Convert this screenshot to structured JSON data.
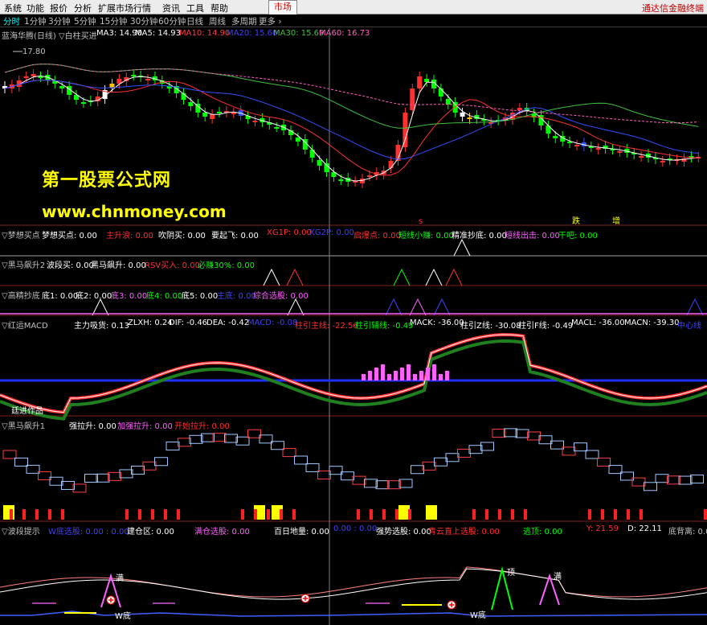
{
  "menu": {
    "items": [
      "系统",
      "功能",
      "报价",
      "分析",
      "扩展市场行情",
      "资讯",
      "工具",
      "帮助"
    ],
    "market_tab": "市场",
    "brand": "通达信金融终端"
  },
  "timeframes": {
    "items": [
      "分时",
      "1分钟",
      "3分钟",
      "5分钟",
      "15分钟",
      "30分钟",
      "60分钟",
      "日线",
      "周线",
      "多周期",
      "更多 ›"
    ],
    "active": "分时"
  },
  "main_panel": {
    "title": "蓝海华腾(日线) ▽白柱买进",
    "indicators": [
      {
        "label": "MA3: 14.90",
        "color": "#ffffff"
      },
      {
        "label": "MA5: 14.93",
        "color": "#ffffff"
      },
      {
        "label": "MA10: 14.90",
        "color": "#ff4040"
      },
      {
        "label": "MA20: 15.60",
        "color": "#4040ff"
      },
      {
        "label": "MA30: 15.69",
        "color": "#40c040"
      },
      {
        "label": "MA60: 16.73",
        "color": "#ff60c0"
      }
    ],
    "high_label": "17.80",
    "marks": [
      {
        "text": "s",
        "color": "#ff3030"
      },
      {
        "text": "跌",
        "color": "#ffff00"
      },
      {
        "text": "增",
        "color": "#ffff00"
      }
    ]
  },
  "watermark": {
    "line1": "第一股票公式网",
    "line2": "www.chnmoney.com"
  },
  "panel1": {
    "items": [
      {
        "label": "▽梦想买点",
        "color": "#c0c0c0"
      },
      {
        "label": "梦想买点: 0.00",
        "color": "#ffffff"
      },
      {
        "label": "主升浪: 0.00",
        "color": "#ff3030"
      },
      {
        "label": "吹阴买: 0.00",
        "color": "#ffffff"
      },
      {
        "label": "要起飞: 0.00",
        "color": "#ffffff"
      },
      {
        "label": "XG1P: 0.00",
        "color": "#ff3030"
      },
      {
        "label": "XG2P: 0.00",
        "color": "#4040ff"
      },
      {
        "label": "启爆点: 0.00",
        "color": "#ff3030"
      },
      {
        "label": "短线小赚: 0.00",
        "color": "#00ff00"
      },
      {
        "label": "精准抄底: 0.00",
        "color": "#ffffff"
      },
      {
        "label": "短线出击: 0.00",
        "color": "#ff60ff"
      },
      {
        "label": "干吧: 0.00",
        "color": "#00ff00"
      }
    ]
  },
  "panel2": {
    "items": [
      {
        "label": "▽黑马飙升2",
        "color": "#c0c0c0"
      },
      {
        "label": "波段买: 0.00",
        "color": "#ffffff"
      },
      {
        "label": "黑马飙升: 0.00",
        "color": "#ffffff"
      },
      {
        "label": "RSV买入: 0.00",
        "color": "#ff3030"
      },
      {
        "label": "必赚30%: 0.00",
        "color": "#00ff00"
      }
    ]
  },
  "panel3": {
    "items": [
      {
        "label": "▽高精抄底",
        "color": "#c0c0c0"
      },
      {
        "label": "底1: 0.00",
        "color": "#ffffff"
      },
      {
        "label": "底2: 0.00",
        "color": "#ffffff"
      },
      {
        "label": "底3: 0.00",
        "color": "#ff60ff"
      },
      {
        "label": "底4: 0.00",
        "color": "#00ff00"
      },
      {
        "label": "底5: 0.00",
        "color": "#ffffff"
      },
      {
        "label": "主底: 0.00",
        "color": "#4040ff"
      },
      {
        "label": "综合选股: 0.00",
        "color": "#ff60ff"
      }
    ]
  },
  "panel4": {
    "items": [
      {
        "label": "▽红运MACD",
        "color": "#c0c0c0"
      },
      {
        "label": "主力吸货: 0.13",
        "color": "#ffffff"
      },
      {
        "label": "ZLXH: 0.24",
        "color": "#ffffff"
      },
      {
        "label": "DIF: -0.46",
        "color": "#ffffff"
      },
      {
        "label": "DEA: -0.42",
        "color": "#ffffff"
      },
      {
        "label": "MACD: -0.08",
        "color": "#4040ff"
      },
      {
        "label": "柱引主线: -22.56",
        "color": "#ff3030"
      },
      {
        "label": "柱引辅线: -0.49",
        "color": "#00ff00"
      },
      {
        "label": "MACK: -36.00",
        "color": "#ffffff"
      },
      {
        "label": "柱引Z线: -30.08",
        "color": "#ffffff"
      },
      {
        "label": "柱引F线: -0.49",
        "color": "#ffffff"
      },
      {
        "label": "MACL: -36.00",
        "color": "#ffffff"
      },
      {
        "label": "MACN: -39.30",
        "color": "#ffffff"
      },
      {
        "label": "中心线",
        "color": "#4040ff"
      }
    ],
    "author": "廷进作品"
  },
  "panel5": {
    "items": [
      {
        "label": "▽黑马飙升1",
        "color": "#c0c0c0"
      },
      {
        "label": "强拉升: 0.00",
        "color": "#ffffff"
      },
      {
        "label": "加强拉升: 0.00",
        "color": "#ff60ff"
      },
      {
        "label": "开始拉升: 0.00",
        "color": "#ff3030"
      }
    ]
  },
  "panel6": {
    "items": [
      {
        "label": "▽波段提示",
        "color": "#c0c0c0"
      },
      {
        "label": "W底选股: 0.00 : 0.00",
        "color": "#4040ff"
      },
      {
        "label": "建仓区: 0.00",
        "color": "#ffffff"
      },
      {
        "label": "满仓选股: 0.00",
        "color": "#ff60ff"
      },
      {
        "label": "百日地量: 0.00",
        "color": "#ffffff"
      },
      {
        "label": "0.00 : 0.00",
        "color": "#4040ff"
      },
      {
        "label": "强势选股: 0.00",
        "color": "#ffffff"
      },
      {
        "label": "青云直上选股: 0.00",
        "color": "#ff3030"
      },
      {
        "label": "逃顶: 0.00",
        "color": "#00ff00"
      },
      {
        "label": "Y: 21.59",
        "color": "#ff3030"
      },
      {
        "label": "D: 22.11",
        "color": "#ffffff"
      },
      {
        "label": "底背离: 0.00",
        "color": "#c0c0c0"
      }
    ],
    "labels": {
      "ding": "顶",
      "man": "满",
      "w_di": "W底"
    }
  }
}
